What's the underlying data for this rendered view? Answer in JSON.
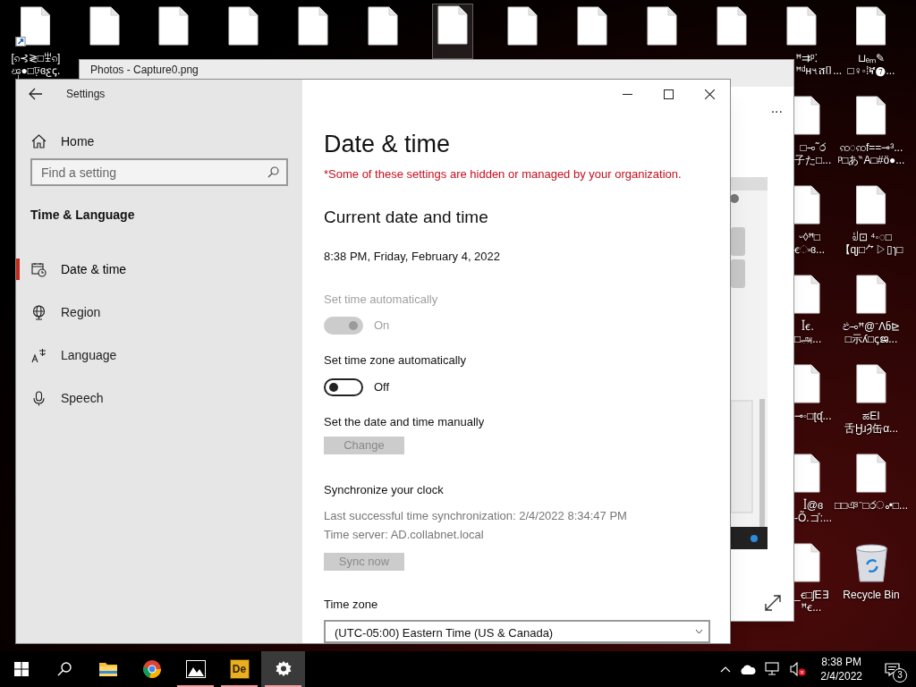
{
  "desktop": {
    "top_icons": [
      {
        "kind": "file",
        "shortcut": true,
        "selected": false,
        "label_lines": [
          "[ၵ⊰≷□ꄻၵ]",
          "ၾ●□ঢ়ɞꜫꞔ."
        ]
      },
      {
        "kind": "file",
        "shortcut": false,
        "selected": false
      },
      {
        "kind": "file",
        "shortcut": false,
        "selected": false
      },
      {
        "kind": "file",
        "shortcut": false,
        "selected": false
      },
      {
        "kind": "file",
        "shortcut": false,
        "selected": false
      },
      {
        "kind": "file",
        "shortcut": false,
        "selected": false
      },
      {
        "kind": "file",
        "shortcut": false,
        "selected": true
      },
      {
        "kind": "file",
        "shortcut": false,
        "selected": false
      },
      {
        "kind": "file",
        "shortcut": false,
        "selected": false
      },
      {
        "kind": "file",
        "shortcut": false,
        "selected": false
      },
      {
        "kind": "file",
        "shortcut": false,
        "selected": false
      },
      {
        "kind": "file",
        "shortcut": false,
        "selected": false,
        "label_lines": [
          "ꟸ⇉ᵖ⁚",
          "ꟸᵈʜ৭ሸ▯..."
        ]
      },
      {
        "kind": "file",
        "shortcut": false,
        "selected": false,
        "label_lines": [
          "⊔ₑₘ✎",
          "□♀◦⁞ኛ❼..."
        ]
      }
    ],
    "column_a": [
      {
        "kind": "file",
        "label_lines": [
          "□⊸˜ර",
          "子た□..."
        ]
      },
      {
        "kind": "file",
        "label_lines": [
          "ᵕ◊ꟸ□",
          "ꞓංɞ..."
        ]
      },
      {
        "kind": "file",
        "label_lines": [
          "ꟾꞓ.",
          "□அ..."
        ]
      },
      {
        "kind": "file",
        "label_lines": [
          "⊸◦□ʈᶑ..."
        ]
      },
      {
        "kind": "file",
        "label_lines": [
          "ꟾ@ɞ",
          "-Õ.ゴ:..."
        ]
      },
      {
        "kind": "file",
        "label_lines": [
          "_ꞓ□ʃE∃",
          "ꟸꞓ..."
        ]
      }
    ],
    "column_b": [
      {
        "kind": "file",
        "label_lines": [
          "ꩡ◌ꩡf==⊸³...",
          "ᵖ□あ‶A□#ö●..."
        ]
      },
      {
        "kind": "file",
        "label_lines": [
          "ꆽ⊡ ⁴◦◌□",
          "【ɋȷ□⺈▷▯ɿ□"
        ]
      },
      {
        "kind": "file",
        "label_lines": [
          "ඵ⊸ꟸ@⁻ᐱნ⊵",
          "□示ʎ□ꞔജ..."
        ]
      },
      {
        "kind": "file",
        "label_lines": [
          "ಹEI",
          "舌ӇɹȜ缶α..."
        ]
      },
      {
        "kind": "file",
        "label_lines": [
          "□□ঞ⁻□රം•□..."
        ]
      },
      {
        "kind": "recycle",
        "label_lines": [
          "Recycle Bin"
        ]
      }
    ]
  },
  "photos_window": {
    "title": "Photos - Capture0.png",
    "more": "..."
  },
  "settings": {
    "title": "Settings",
    "home": "Home",
    "search": {
      "placeholder": "Find a setting"
    },
    "section": "Time & Language",
    "nav": [
      {
        "kind": "calendar",
        "label": "Date & time",
        "selected": true
      },
      {
        "kind": "globe",
        "label": "Region",
        "selected": false
      },
      {
        "kind": "language",
        "label": "Language",
        "selected": false
      },
      {
        "kind": "mic",
        "label": "Speech",
        "selected": false
      }
    ],
    "heading": "Date & time",
    "notice": "*Some of these settings are hidden or managed by your organization.",
    "current_heading": "Current date and time",
    "current": "8:38 PM, Friday, February 4, 2022",
    "toggles": [
      {
        "label": "Set time automatically",
        "on": true,
        "disabled": true,
        "state_text": "On"
      },
      {
        "label": "Set time zone automatically",
        "on": false,
        "disabled": false,
        "state_text": "Off"
      }
    ],
    "manual_label": "Set the date and time manually",
    "change_button": {
      "label": "Change",
      "disabled": true
    },
    "sync_heading": "Synchronize your clock",
    "sync_lines": [
      "Last successful time synchronization: 2/4/2022 8:34:47 PM",
      "Time server: AD.collabnet.local"
    ],
    "sync_button": {
      "label": "Sync now",
      "disabled": true
    },
    "timezone_label": "Time zone",
    "timezone_value": "(UTC-05:00) Eastern Time (US & Canada)"
  },
  "taskbar": {
    "apps": [
      {
        "kind": "explorer",
        "active": false,
        "running": false
      },
      {
        "kind": "chrome",
        "active": false,
        "running": false
      },
      {
        "kind": "photos",
        "active": false,
        "running": true
      },
      {
        "kind": "de",
        "label": "De",
        "active": false,
        "running": true
      },
      {
        "kind": "settings",
        "active": true,
        "running": true
      }
    ],
    "time": "8:38 PM",
    "date": "2/4/2022",
    "notifications": "3"
  }
}
